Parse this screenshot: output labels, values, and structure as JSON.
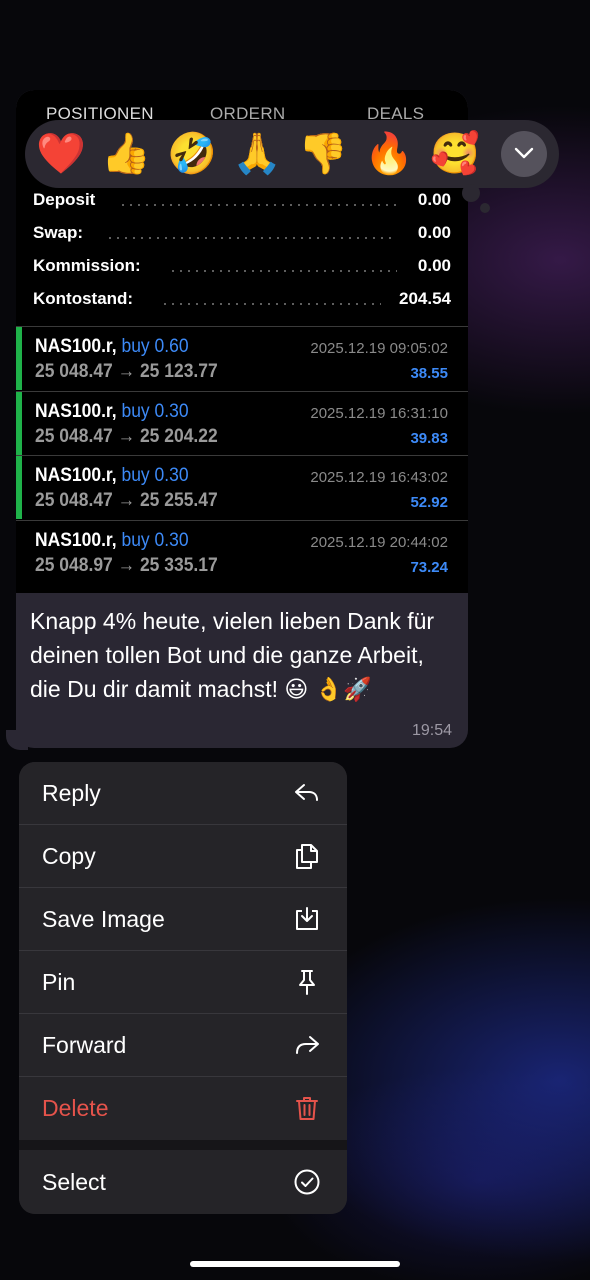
{
  "screenshot": {
    "tabs": [
      "POSITIONEN",
      "ORDERN",
      "DEALS"
    ],
    "summary": [
      {
        "label": "Deposit",
        "value": "0.00"
      },
      {
        "label": "Swap:",
        "value": "0.00"
      },
      {
        "label": "Kommission:",
        "value": "0.00"
      },
      {
        "label": "Kontostand:",
        "value": "204.54"
      }
    ],
    "trades": [
      {
        "symbol": "NAS100.r,",
        "direction": "buy 0.60",
        "prices": "25 048.47 → 25 123.77",
        "time": "2025.12.19 09:05:02",
        "profit": "38.55"
      },
      {
        "symbol": "NAS100.r,",
        "direction": "buy 0.30",
        "prices": "25 048.47 → 25 204.22",
        "time": "2025.12.19 16:31:10",
        "profit": "39.83"
      },
      {
        "symbol": "NAS100.r,",
        "direction": "buy 0.30",
        "prices": "25 048.47 → 25 255.47",
        "time": "2025.12.19 16:43:02",
        "profit": "52.92"
      },
      {
        "symbol": "NAS100.r,",
        "direction": "buy 0.30",
        "prices": "25 048.97 → 25 335.17",
        "time": "2025.12.19 20:44:02",
        "profit": "73.24"
      }
    ]
  },
  "message": {
    "text": "Knapp 4% heute, vielen lieben Dank für deinen tollen Bot und die ganze Arbeit, die Du dir damit machst! 😃 👌🚀",
    "time": "19:54"
  },
  "reactions": [
    "❤️",
    "👍",
    "🤣",
    "🙏",
    "👎",
    "🔥",
    "🥰"
  ],
  "menu": {
    "reply": "Reply",
    "copy": "Copy",
    "save_image": "Save Image",
    "pin": "Pin",
    "forward": "Forward",
    "delete": "Delete",
    "select": "Select"
  },
  "colors": {
    "accent_blue": "#3d8af7",
    "position_bar_green": "#1fb24a",
    "delete_red": "#e5534b"
  }
}
